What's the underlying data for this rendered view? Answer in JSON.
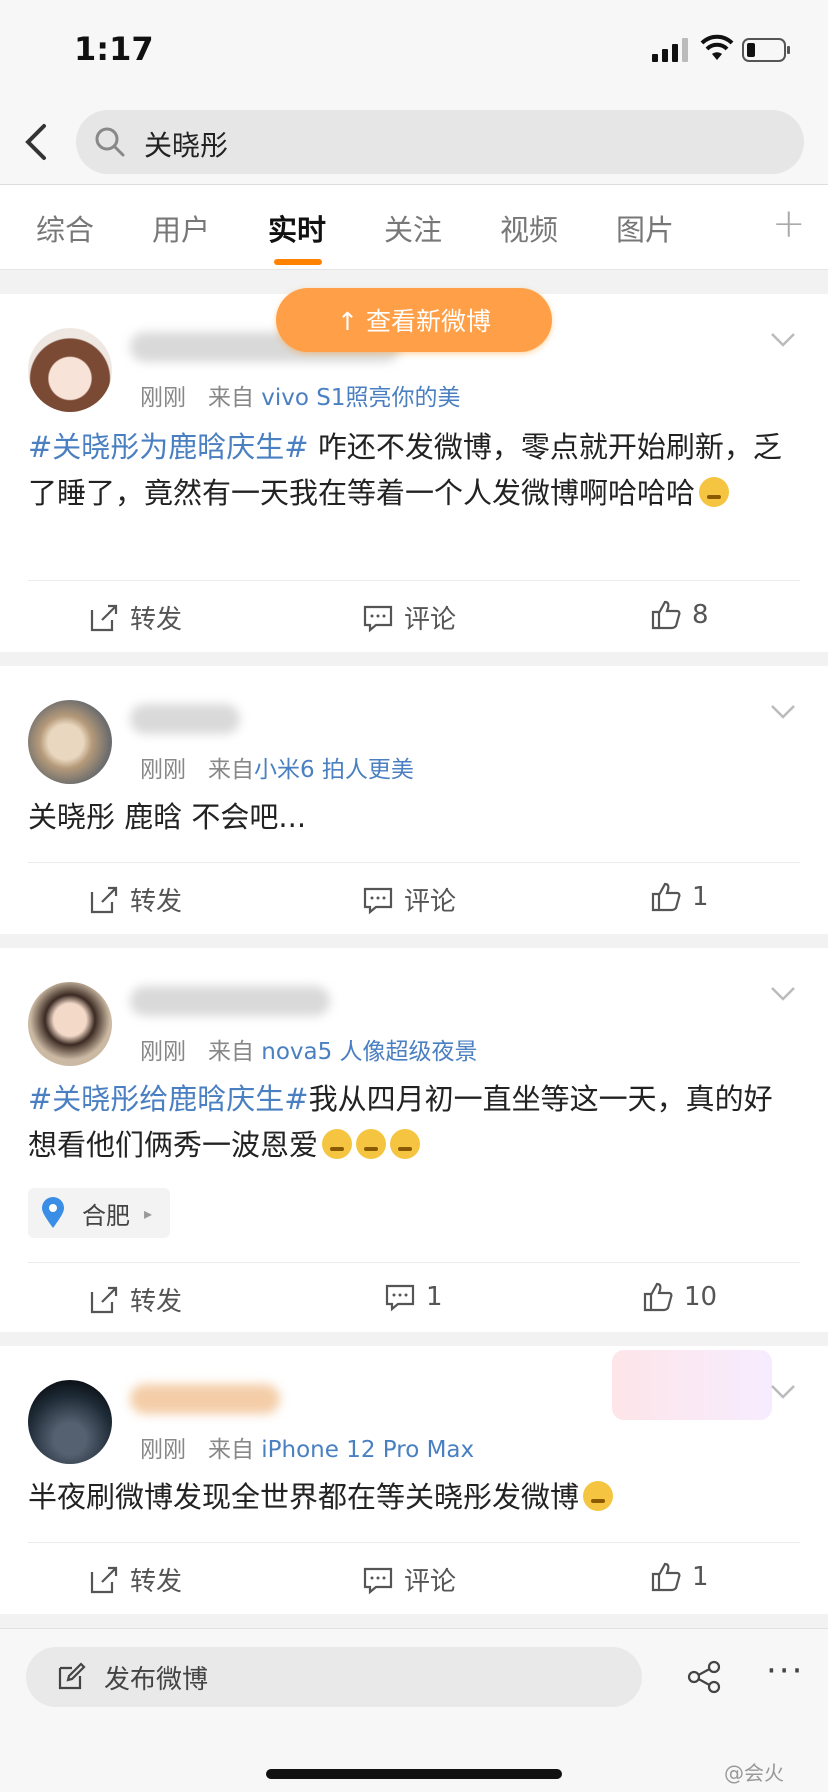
{
  "status": {
    "time": "1:17"
  },
  "search": {
    "query": "关晓彤"
  },
  "tabs": [
    "综合",
    "用户",
    "实时",
    "关注",
    "视频",
    "图片"
  ],
  "active_tab": "实时",
  "toast": "↑ 查看新微博",
  "posts": [
    {
      "time": "刚刚",
      "from_prefix": "来自",
      "source": "vivo S1照亮你的美",
      "topic": "#关晓彤为鹿晗庆生#",
      "text": " 咋还不发微博，零点就开始刷新，乏了睡了，竟然有一天我在等着一个人发微博啊哈哈哈",
      "repost": "转发",
      "comment": "评论",
      "likes": "8"
    },
    {
      "time": "刚刚",
      "from_prefix": "来自",
      "source": "小米6 拍人更美",
      "topic": "",
      "text": "关晓彤 鹿晗 不会吧...",
      "repost": "转发",
      "comment": "评论",
      "likes": "1"
    },
    {
      "time": "刚刚",
      "from_prefix": "来自",
      "source": "nova5 人像超级夜景",
      "topic": "#关晓彤给鹿晗庆生#",
      "text": "我从四月初一直坐等这一天，真的好想看他们俩秀一波恩爱",
      "location": "合肥",
      "repost": "转发",
      "comment": "1",
      "likes": "10"
    },
    {
      "time": "刚刚",
      "from_prefix": "来自",
      "source": "iPhone 12 Pro Max",
      "topic": "",
      "text": "半夜刷微博发现全世界都在等关晓彤发微博",
      "repost": "转发",
      "comment": "评论",
      "likes": "1"
    }
  ],
  "bottom": {
    "compose": "发布微博",
    "more": "···",
    "watermark": "@会火"
  },
  "colors": {
    "accent": "#ff8200",
    "link": "#4a7fc1",
    "toast": "#ffa049"
  }
}
